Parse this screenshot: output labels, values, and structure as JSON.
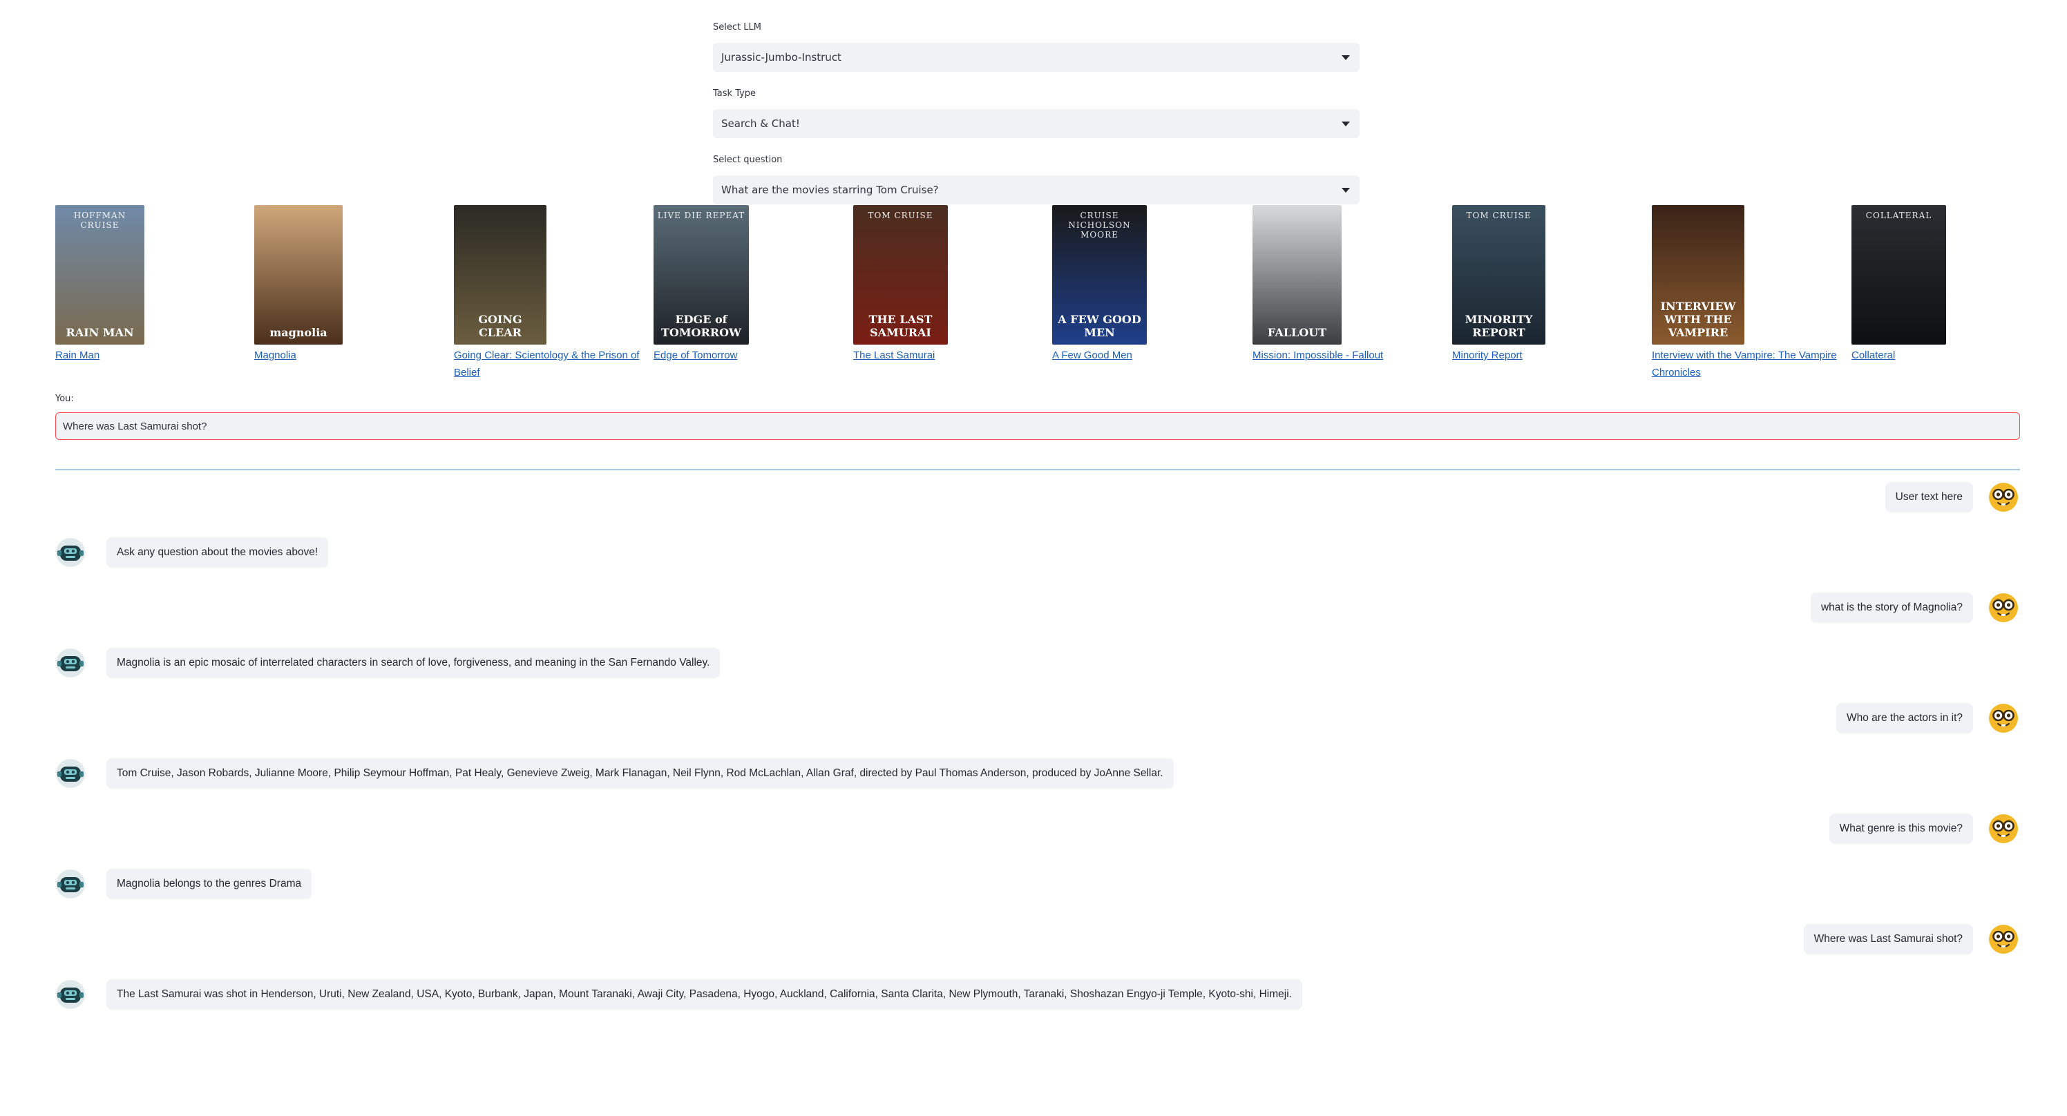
{
  "selectors": [
    {
      "label": "Select LLM",
      "value": "Jurassic-Jumbo-Instruct"
    },
    {
      "label": "Task Type",
      "value": "Search & Chat!"
    },
    {
      "label": "Select question",
      "value": "What are the movies starring Tom Cruise?"
    }
  ],
  "movies": [
    {
      "title": "Rain Man",
      "poster_top": "HOFFMAN  CRUISE",
      "poster_bottom": "RAIN MAN",
      "colors": [
        "#6f8aa8",
        "#7a6a4e"
      ]
    },
    {
      "title": "Magnolia",
      "poster_top": "",
      "poster_bottom": "magnolia",
      "colors": [
        "#cfa77a",
        "#4a2f1c"
      ]
    },
    {
      "title": "Going Clear: Scientology & the Prison of Belief",
      "poster_top": "",
      "poster_bottom": "GOING CLEAR",
      "colors": [
        "#2b2a24",
        "#6b5d3e"
      ]
    },
    {
      "title": "Edge of Tomorrow",
      "poster_top": "LIVE DIE REPEAT",
      "poster_bottom": "EDGE of TOMORROW",
      "colors": [
        "#5b6d78",
        "#1e2227"
      ]
    },
    {
      "title": "The Last Samurai",
      "poster_top": "TOM CRUISE",
      "poster_bottom": "THE LAST SAMURAI",
      "colors": [
        "#4a2e20",
        "#7a1e14"
      ]
    },
    {
      "title": "A Few Good Men",
      "poster_top": "CRUISE  NICHOLSON  MOORE",
      "poster_bottom": "A FEW GOOD MEN",
      "colors": [
        "#1a1a1a",
        "#1f3f8a"
      ]
    },
    {
      "title": "Mission: Impossible - Fallout",
      "poster_top": "",
      "poster_bottom": "FALLOUT",
      "colors": [
        "#d8d9da",
        "#3b3d40"
      ]
    },
    {
      "title": "Minority Report",
      "poster_top": "TOM CRUISE",
      "poster_bottom": "MINORITY REPORT",
      "colors": [
        "#3a4f5e",
        "#1a2530"
      ]
    },
    {
      "title": "Interview with the Vampire: The Vampire Chronicles",
      "poster_top": "",
      "poster_bottom": "INTERVIEW WITH THE VAMPIRE",
      "colors": [
        "#3a2418",
        "#8a5a2e"
      ]
    },
    {
      "title": "Collateral",
      "poster_top": "COLLATERAL",
      "poster_bottom": "",
      "colors": [
        "#2a2e32",
        "#0e0f11"
      ]
    }
  ],
  "chat": {
    "input_label": "You:",
    "input_value": "Where was Last Samurai shot?",
    "messages": [
      {
        "role": "user",
        "text": "User text here"
      },
      {
        "role": "bot",
        "text": "Ask any question about the movies above!"
      },
      {
        "role": "user",
        "text": "what is the story of Magnolia?"
      },
      {
        "role": "bot",
        "text": "Magnolia is an epic mosaic of interrelated characters in search of love, forgiveness, and meaning in the San Fernando Valley."
      },
      {
        "role": "user",
        "text": "Who are the actors in it?"
      },
      {
        "role": "bot",
        "text": "Tom Cruise, Jason Robards, Julianne Moore, Philip Seymour Hoffman, Pat Healy, Genevieve Zweig, Mark Flanagan, Neil Flynn, Rod McLachlan, Allan Graf, directed by Paul Thomas Anderson, produced by JoAnne Sellar."
      },
      {
        "role": "user",
        "text": "What genre is this movie?"
      },
      {
        "role": "bot",
        "text": "Magnolia belongs to the genres Drama"
      },
      {
        "role": "user",
        "text": "Where was Last Samurai shot?"
      },
      {
        "role": "bot",
        "text": "The Last Samurai was shot in Henderson, Uruti, New Zealand, USA, Kyoto, Burbank, Japan, Mount Taranaki, Awaji City, Pasadena, Hyogo, Auckland, California, Santa Clarita, New Plymouth, Taranaki, Shoshazan Engyo-ji Temple, Kyoto-shi, Himeji."
      }
    ],
    "user_avatar_icon": "nerd-face-icon",
    "bot_avatar_icon": "robot-icon"
  }
}
